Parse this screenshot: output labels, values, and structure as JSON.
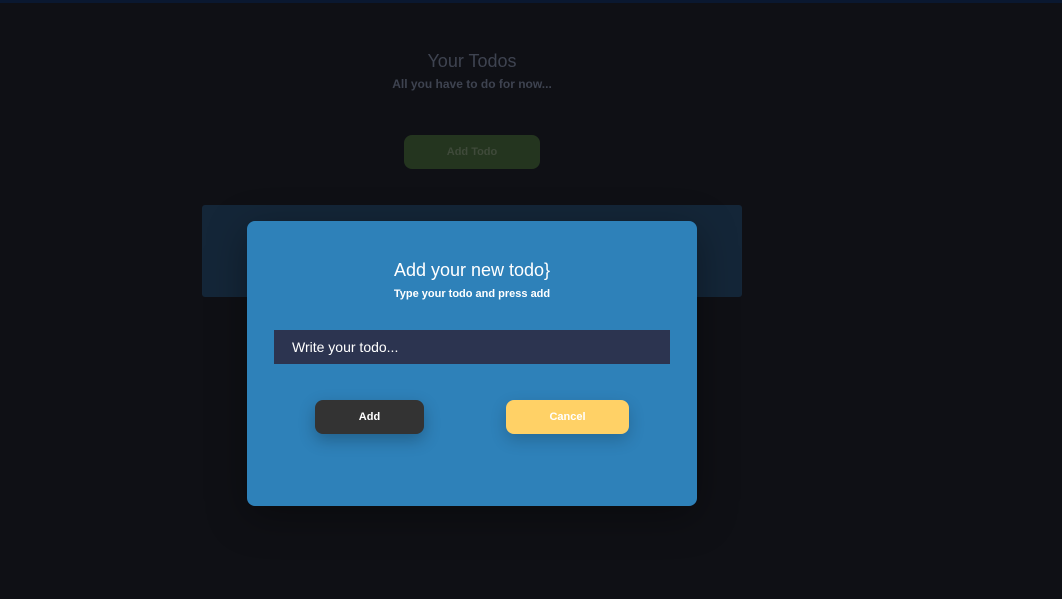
{
  "background": {
    "title": "Your Todos",
    "subtitle": "All you have to do for now...",
    "add_todo_label": "Add Todo"
  },
  "modal": {
    "title": "Add your new todo}",
    "subtitle": "Type your todo and press add",
    "input": {
      "placeholder": "Write your todo...",
      "value": ""
    },
    "add_label": "Add",
    "cancel_label": "Cancel"
  },
  "colors": {
    "page_background": "#0f1015",
    "modal_background": "#2e81b9",
    "input_background": "#2c3450",
    "add_button": "#333333",
    "cancel_button": "#ffd166"
  }
}
